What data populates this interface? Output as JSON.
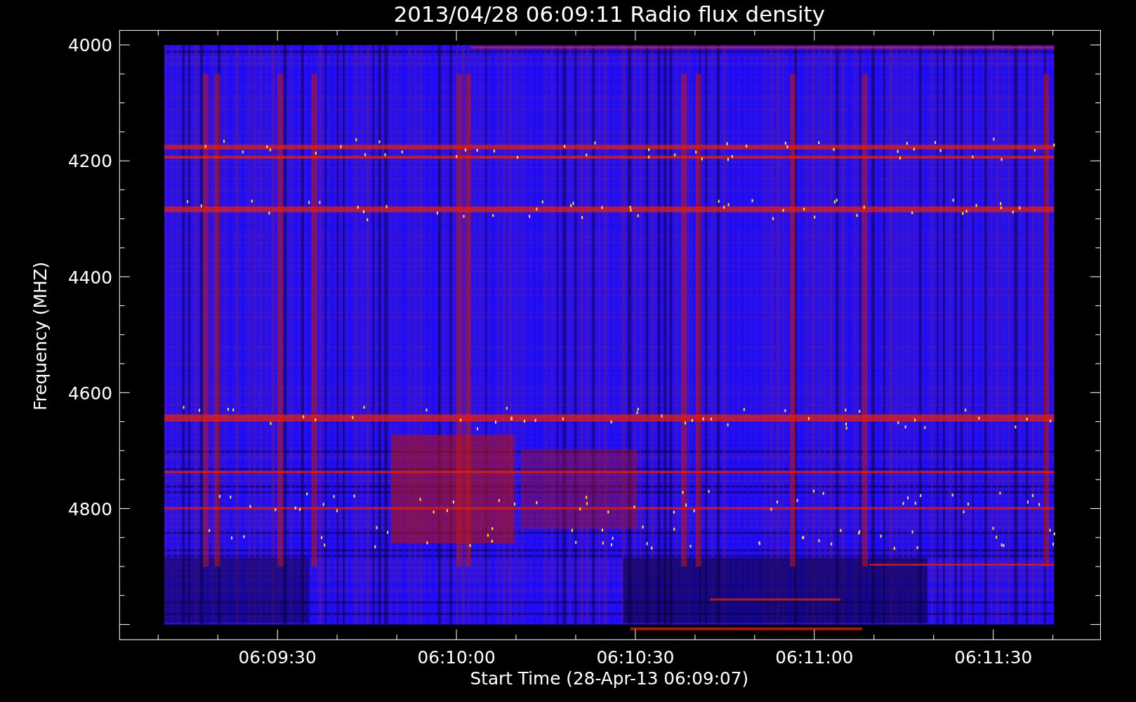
{
  "chart": {
    "title": "2013/04/28 06:09:11 Radio flux density",
    "ylabel": "Frequency (MHZ)",
    "xlabel": "Start Time (28-Apr-13 06:09:07)",
    "yticks": [
      "4000",
      "4200",
      "4400",
      "4600",
      "4800"
    ],
    "xticks": [
      "06:09:30",
      "06:10:00",
      "06:10:30",
      "06:11:00",
      "06:11:30"
    ]
  }
}
